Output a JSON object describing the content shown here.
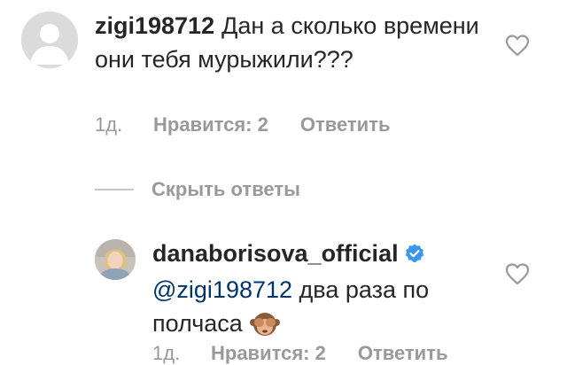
{
  "comment": {
    "username": "zigi198712",
    "text": "Дан  а сколько времени  они  тебя мурыжили???",
    "time": "1д.",
    "likes": "Нравится: 2",
    "reply_label": "Ответить"
  },
  "replies_toggle": {
    "label": "Скрыть ответы"
  },
  "reply": {
    "username": "danaborisova_official",
    "mention": "@zigi198712",
    "text": " два раза по полчаса",
    "time": "1д.",
    "likes": "Нравится: 2",
    "reply_label": "Ответить",
    "emoji": "see-no-evil-monkey-icon"
  },
  "colors": {
    "username": "#262626",
    "meta": "#999999",
    "mention": "#003569",
    "verified": "#3897f0"
  }
}
